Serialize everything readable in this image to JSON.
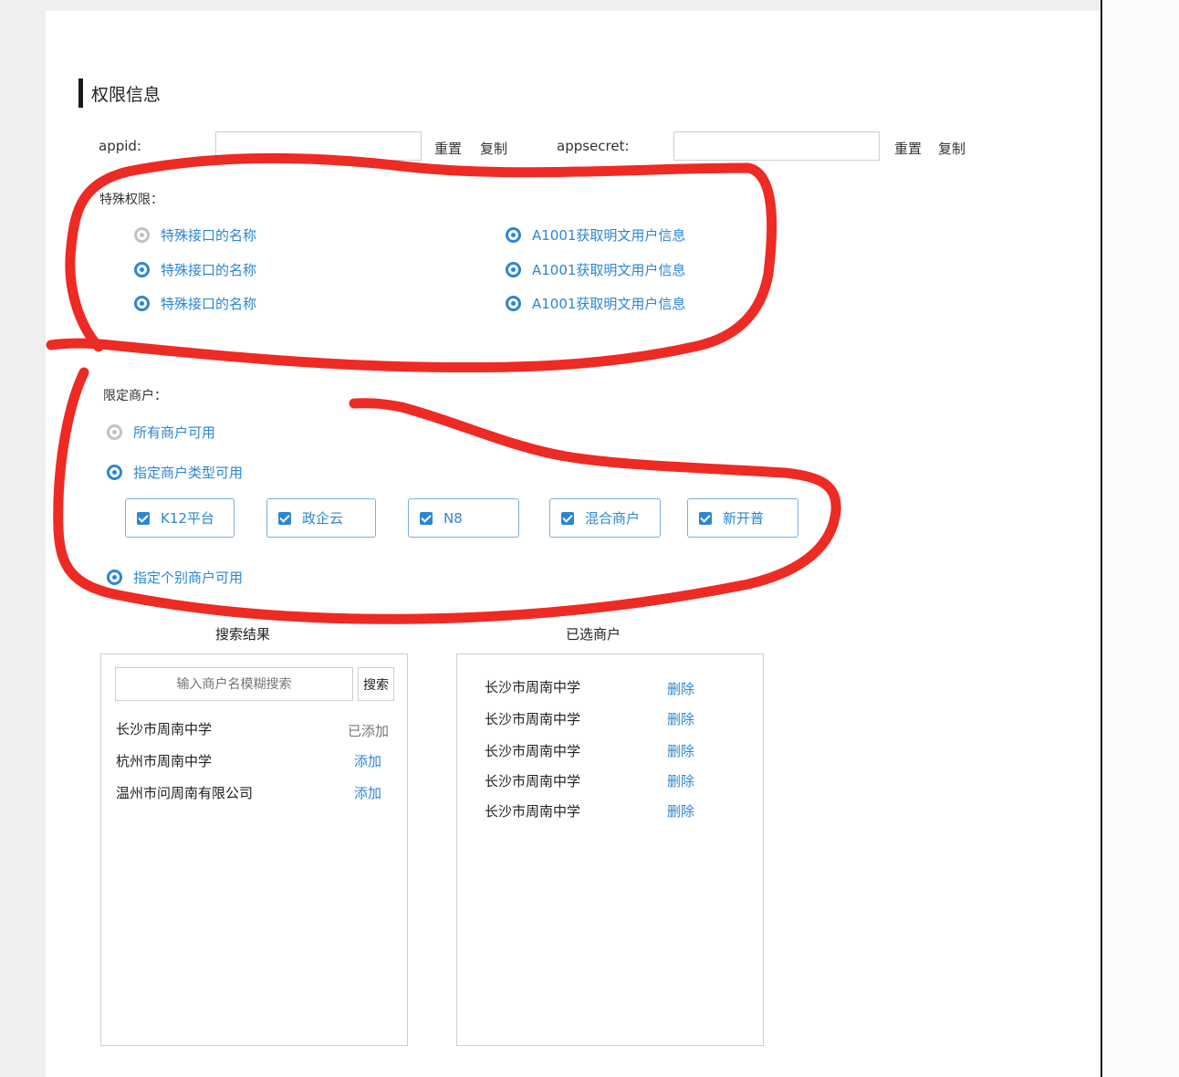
{
  "section": {
    "title": "权限信息"
  },
  "credentials": {
    "appid_label": "appid:",
    "appid_value": "",
    "appid_reset": "重置",
    "appid_copy": "复制",
    "appsecret_label": "appsecret:",
    "appsecret_value": "",
    "appsecret_reset": "重置",
    "appsecret_copy": "复制"
  },
  "special_permissions": {
    "label": "特殊权限：",
    "left": [
      {
        "label": "特殊接口的名称",
        "selected": false
      },
      {
        "label": "特殊接口的名称",
        "selected": true
      },
      {
        "label": "特殊接口的名称",
        "selected": true
      }
    ],
    "right": [
      {
        "label": "A1001获取明文用户信息",
        "selected": true
      },
      {
        "label": "A1001获取明文用户信息",
        "selected": true
      },
      {
        "label": "A1001获取明文用户信息",
        "selected": true
      }
    ]
  },
  "merchant_limit": {
    "label": "限定商户：",
    "options": [
      {
        "label": "所有商户可用",
        "selected": false
      },
      {
        "label": "指定商户类型可用",
        "selected": true
      },
      {
        "label": "指定个别商户可用",
        "selected": true
      }
    ],
    "types": [
      {
        "label": "K12平台",
        "checked": true
      },
      {
        "label": "政企云",
        "checked": true
      },
      {
        "label": "N8",
        "checked": true
      },
      {
        "label": "混合商户",
        "checked": true
      },
      {
        "label": "新开普",
        "checked": true
      }
    ]
  },
  "search_results": {
    "title": "搜索结果",
    "placeholder": "输入商户名模糊搜索",
    "search_button": "搜索",
    "items": [
      {
        "name": "长沙市周南中学",
        "action": "已添加"
      },
      {
        "name": "杭州市周南中学",
        "action": "添加"
      },
      {
        "name": "温州市问周南有限公司",
        "action": "添加"
      }
    ]
  },
  "selected_merchants": {
    "title": "已选商户",
    "items": [
      {
        "name": "长沙市周南中学",
        "action": "删除"
      },
      {
        "name": "长沙市周南中学",
        "action": "删除"
      },
      {
        "name": "长沙市周南中学",
        "action": "删除"
      },
      {
        "name": "长沙市周南中学",
        "action": "删除"
      },
      {
        "name": "长沙市周南中学",
        "action": "删除"
      }
    ]
  },
  "colors": {
    "accent": "#2b86d4",
    "annotation": "#ee2a24",
    "border": "#cfcfcf"
  }
}
